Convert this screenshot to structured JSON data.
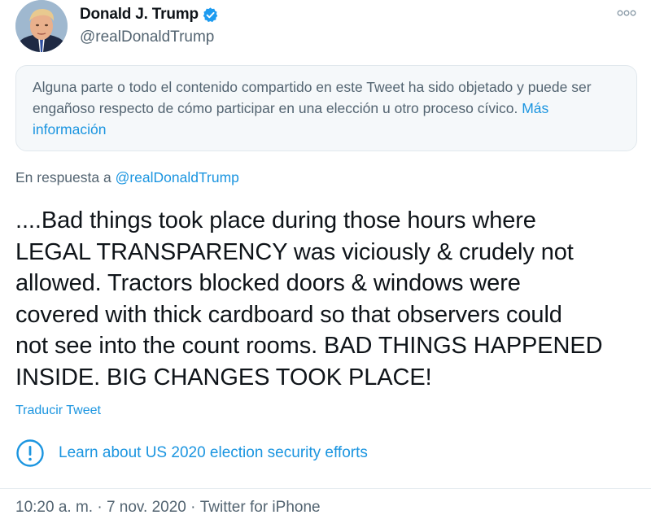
{
  "author": {
    "name": "Donald J. Trump",
    "handle": "@realDonaldTrump",
    "verified": true
  },
  "notice": {
    "text": "Alguna parte o todo el contenido compartido en este Tweet ha sido objetado y puede ser engañoso respecto de cómo participar en una elección u otro proceso cívico. ",
    "link": "Más información"
  },
  "reply": {
    "prefix": "En respuesta a ",
    "handle": "@realDonaldTrump"
  },
  "tweet": {
    "text": "....Bad things took place during those hours where\nLEGAL TRANSPARENCY was viciously & crudely not\nallowed. Tractors blocked doors & windows were\ncovered with thick cardboard so that observers could\nnot see into the count rooms. BAD THINGS HAPPENED\nINSIDE. BIG CHANGES TOOK PLACE!"
  },
  "translate_label": "Traducir Tweet",
  "election_label": "Learn about US 2020 election security efforts",
  "meta": {
    "time": "10:20 a. m.",
    "sep1": " · ",
    "date": "7 nov. 2020",
    "sep2": " · ",
    "source": "Twitter for iPhone"
  },
  "colors": {
    "link": "#1b95e0",
    "verified": "#1d9bf0",
    "secondary_text": "#536471"
  },
  "icons": {
    "verified": "verified-badge-icon",
    "more": "more-options-icon",
    "election": "exclamation-circle-icon"
  }
}
